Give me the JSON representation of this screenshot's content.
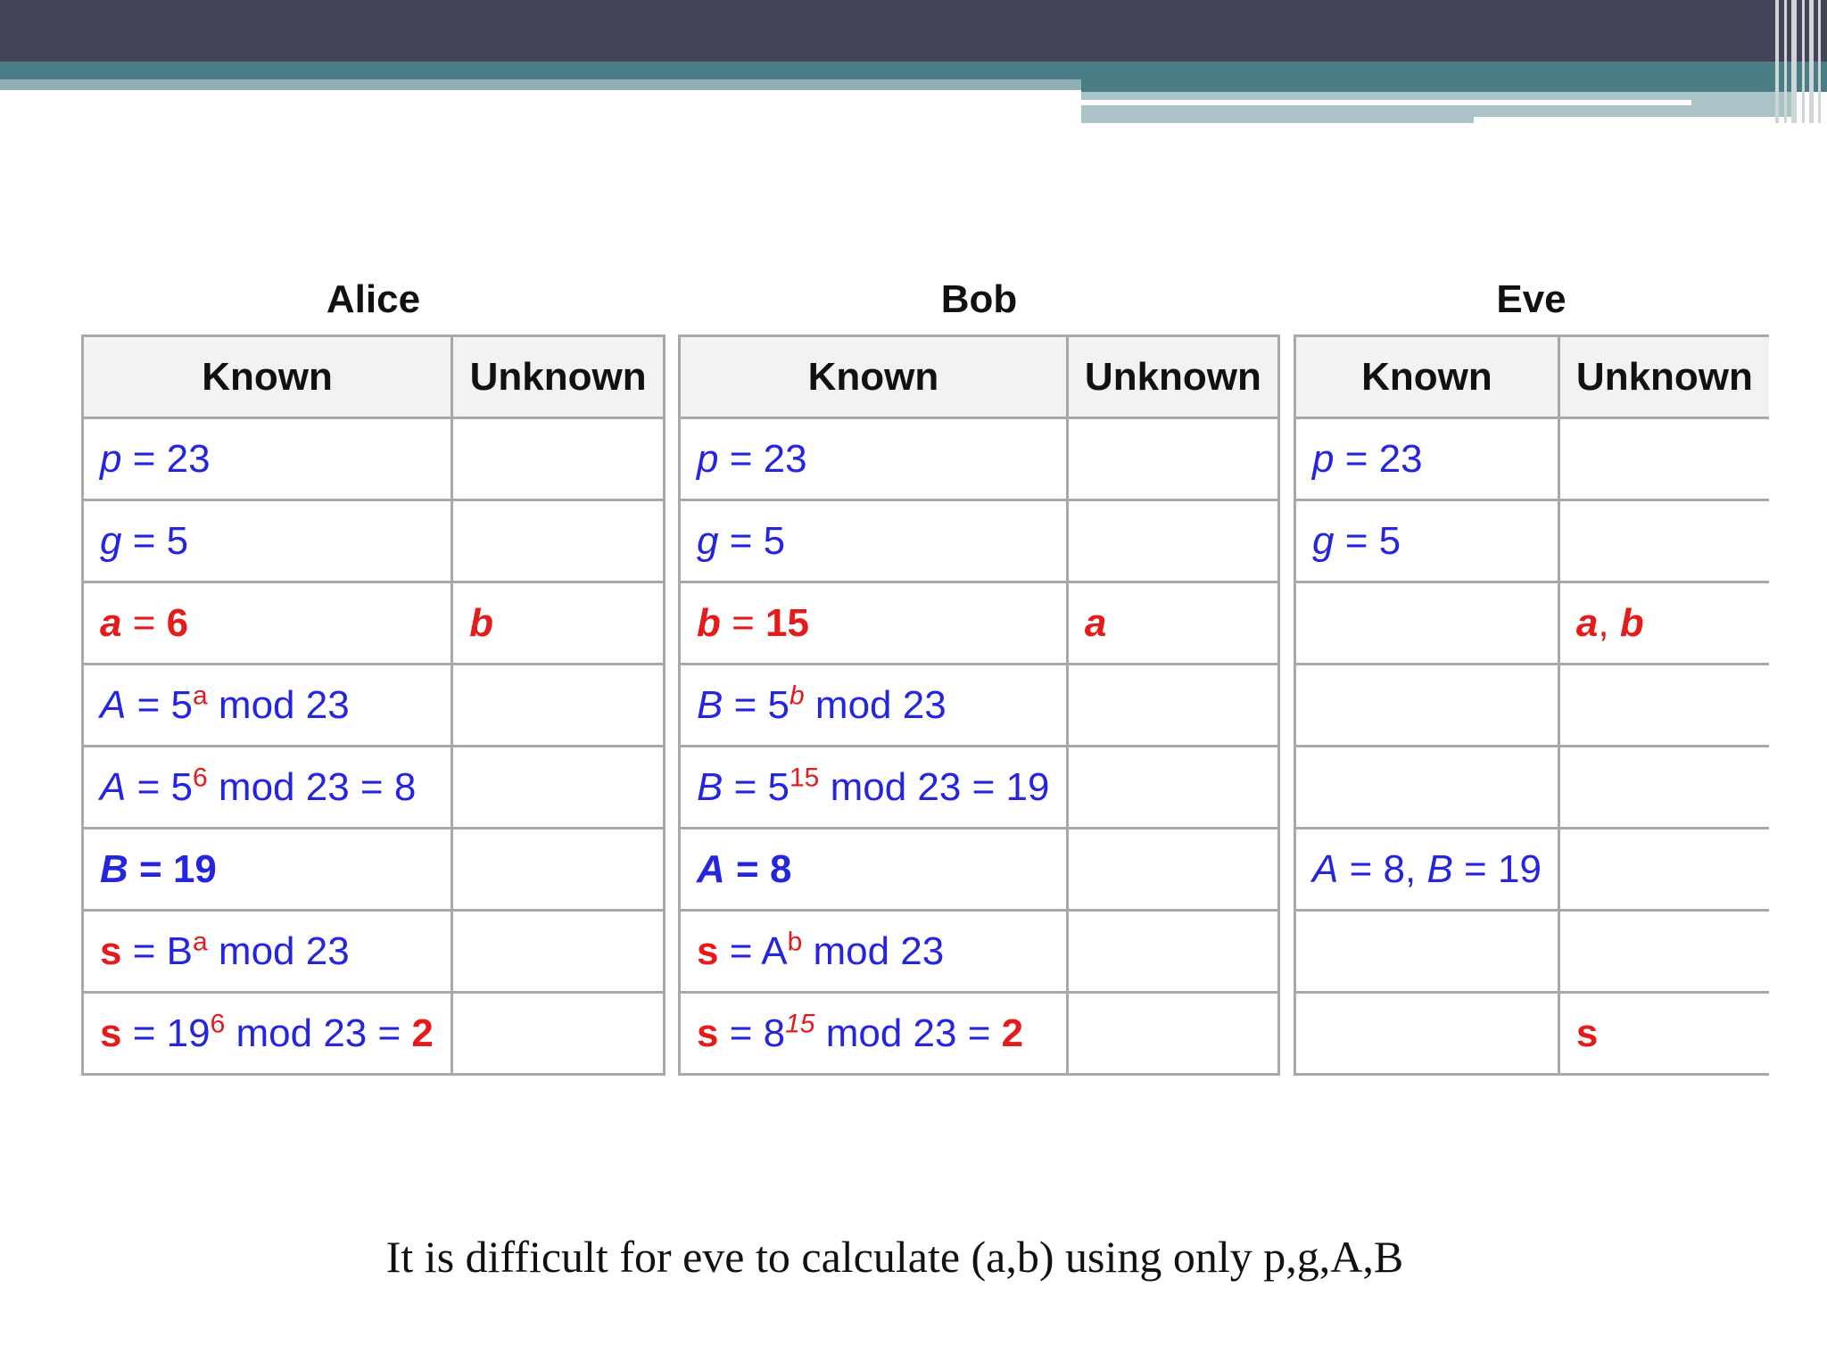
{
  "groups": {
    "alice": {
      "title": "Alice",
      "known_header": "Known",
      "unknown_header": "Unknown"
    },
    "bob": {
      "title": "Bob",
      "known_header": "Known",
      "unknown_header": "Unknown"
    },
    "eve": {
      "title": "Eve",
      "known_header": "Known",
      "unknown_header": "Unknown"
    }
  },
  "t": {
    "p": "p",
    "g": "g",
    "a": "a",
    "b": "b",
    "A": "A",
    "B": "B",
    "s": "s",
    "eq": " = ",
    "comma": ", ",
    "v23": "23",
    "v5": "5",
    "v6": "6",
    "v15": "15",
    "v8": "8",
    "v19": "19",
    "v2": "2",
    "five": "5",
    "nineteen": "19",
    "eight": "8",
    "mod23": " mod 23",
    "mod23eq": " mod 23 = ",
    "sup_a": "a",
    "sup_b": "b",
    "sup_6": "6",
    "sup_15": "15",
    "Btxt": "B",
    "Atxt": "A"
  },
  "caption": "It is difficult for eve to calculate  (a,b) using only p,g,A,B",
  "colors": {
    "known_public": "#2525e0",
    "secret": "#e51a1a",
    "header_bar": "#434456",
    "accent": "#4a7d86"
  }
}
